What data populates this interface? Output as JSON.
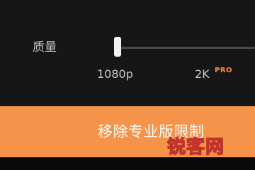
{
  "settings": {
    "quality_label": "质量",
    "slider": {
      "options": [
        "1080p",
        "2K"
      ],
      "selected": "1080p",
      "pro_badge": "PRO"
    }
  },
  "upgrade_button": {
    "label": "移除专业版限制"
  },
  "watermark": {
    "text": "锐客网"
  },
  "colors": {
    "panel_bg": "#161617",
    "accent": "#f6934a",
    "pro_badge": "#ff8a3a"
  }
}
